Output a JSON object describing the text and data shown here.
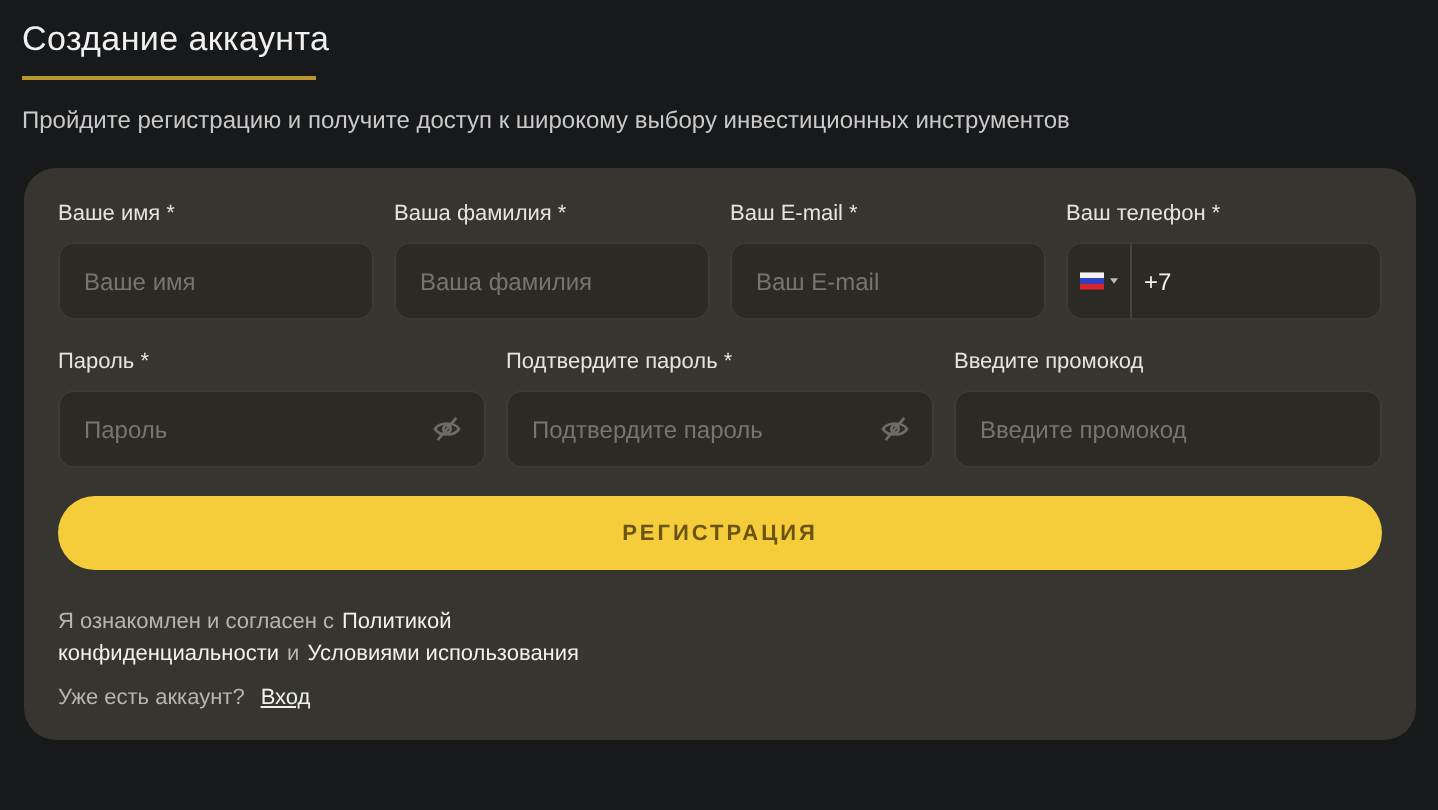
{
  "title": "Создание аккаунта",
  "subtitle": "Пройдите регистрацию и получите доступ к широкому выбору инвестиционных инструментов",
  "rows": [
    [
      {
        "kind": "text",
        "label": "Ваше имя *",
        "placeholder": "Ваше имя"
      },
      {
        "kind": "text",
        "label": "Ваша фамилия *",
        "placeholder": "Ваша фамилия"
      },
      {
        "kind": "text",
        "label": "Ваш E-mail *",
        "placeholder": "Ваш E-mail"
      },
      {
        "kind": "phone",
        "label": "Ваш телефон *",
        "value": "+7"
      }
    ],
    [
      {
        "kind": "password",
        "label": "Пароль *",
        "placeholder": "Пароль"
      },
      {
        "kind": "password",
        "label": "Подтвердите пароль *",
        "placeholder": "Подтвердите пароль"
      },
      {
        "kind": "text",
        "label": "Введите промокод",
        "placeholder": "Введите промокод"
      }
    ]
  ],
  "submit": "РЕГИСТРАЦИЯ",
  "consent_lines": [
    [
      {
        "kind": "text",
        "text": "Я ознакомлен и согласен с"
      },
      {
        "kind": "link",
        "text": "Политикой"
      }
    ],
    [
      {
        "kind": "link",
        "text": "конфиденциальности"
      },
      {
        "kind": "text",
        "text": "и"
      },
      {
        "kind": "link",
        "text": "Условиями использования"
      }
    ]
  ],
  "login": {
    "prompt": "Уже есть аккаунт?",
    "link": "Вход"
  }
}
